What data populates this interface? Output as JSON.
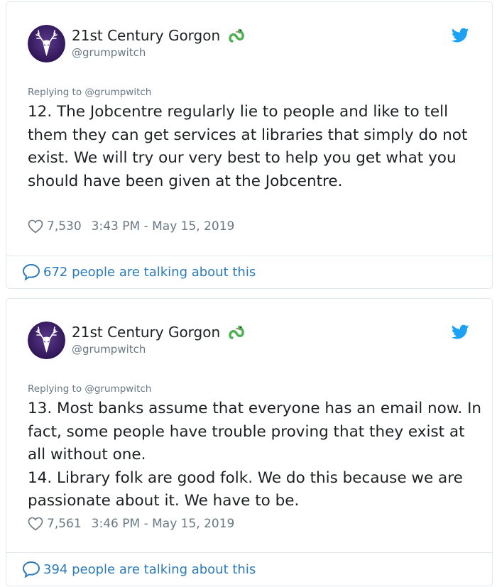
{
  "colors": {
    "link_blue": "#2b7bb9",
    "twitter_blue": "#1da1f2",
    "muted_text": "#697882",
    "body_text": "#1c2022",
    "verified_green": "#4caf50",
    "avatar_purple": "#3b1e6e"
  },
  "tweets": [
    {
      "author": {
        "display_name": "21st Century Gorgon",
        "handle": "@grumpwitch",
        "avatar_icon": "white-stag-avatar",
        "badge_icon": "green-snake-emoji"
      },
      "replying_to": "Replying to @grumpwitch",
      "paragraphs": [
        "12. The Jobcentre regularly lie to people and like to tell them they can get services at libraries that simply do not exist. We will try our very best to help you get what you should have been given at the Jobcentre."
      ],
      "likes": "7,530",
      "timestamp": "3:43 PM - May 15, 2019",
      "talking": "672 people are talking about this"
    },
    {
      "author": {
        "display_name": "21st Century Gorgon",
        "handle": "@grumpwitch",
        "avatar_icon": "white-stag-avatar",
        "badge_icon": "green-snake-emoji"
      },
      "replying_to": "Replying to @grumpwitch",
      "paragraphs": [
        "13. Most banks assume that everyone has an email now. In fact, some people have trouble proving that they exist at all without one.",
        "14. Library folk are good folk. We do this because we are passionate about it. We have to be."
      ],
      "likes": "7,561",
      "timestamp": "3:46 PM - May 15, 2019",
      "talking": "394 people are talking about this"
    }
  ]
}
